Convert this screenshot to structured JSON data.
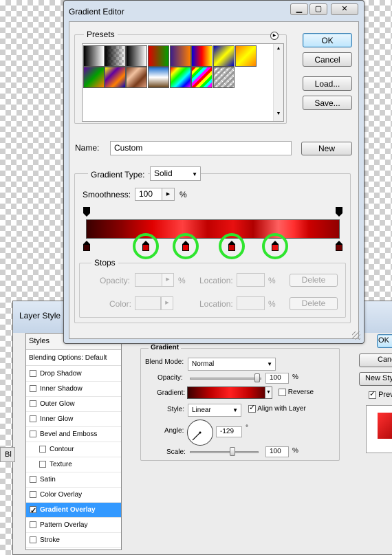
{
  "gradient_editor": {
    "title": "Gradient Editor",
    "presets_label": "Presets",
    "buttons": {
      "ok": "OK",
      "cancel": "Cancel",
      "load": "Load...",
      "save": "Save...",
      "new": "New"
    },
    "name_label": "Name:",
    "name_value": "Custom",
    "gradient_type_label": "Gradient Type:",
    "gradient_type_value": "Solid",
    "smoothness_label": "Smoothness:",
    "smoothness_value": "100",
    "smoothness_unit": "%",
    "stops": {
      "label": "Stops",
      "opacity_label": "Opacity:",
      "opacity_unit": "%",
      "location_label": "Location:",
      "location_unit": "%",
      "color_label": "Color:",
      "delete_label": "Delete"
    }
  },
  "layer_style": {
    "title": "Layer Style",
    "styles_header": "Styles",
    "blending_options": "Blending Options: Default",
    "items": [
      {
        "label": "Drop Shadow",
        "checked": false,
        "indent": false
      },
      {
        "label": "Inner Shadow",
        "checked": false,
        "indent": false
      },
      {
        "label": "Outer Glow",
        "checked": false,
        "indent": false
      },
      {
        "label": "Inner Glow",
        "checked": false,
        "indent": false
      },
      {
        "label": "Bevel and Emboss",
        "checked": false,
        "indent": false
      },
      {
        "label": "Contour",
        "checked": false,
        "indent": true
      },
      {
        "label": "Texture",
        "checked": false,
        "indent": true
      },
      {
        "label": "Satin",
        "checked": false,
        "indent": false
      },
      {
        "label": "Color Overlay",
        "checked": false,
        "indent": false
      },
      {
        "label": "Gradient Overlay",
        "checked": true,
        "indent": false,
        "selected": true
      },
      {
        "label": "Pattern Overlay",
        "checked": false,
        "indent": false
      },
      {
        "label": "Stroke",
        "checked": false,
        "indent": false
      }
    ],
    "gradient_group_label": "Gradient",
    "blend_mode_label": "Blend Mode:",
    "blend_mode_value": "Normal",
    "opacity_label": "Opacity:",
    "opacity_value": "100",
    "opacity_unit": "%",
    "gradient_label": "Gradient:",
    "reverse_label": "Reverse",
    "style_label": "Style:",
    "style_value": "Linear",
    "align_label": "Align with Layer",
    "angle_label": "Angle:",
    "angle_value": "-129",
    "angle_unit": "°",
    "scale_label": "Scale:",
    "scale_value": "100",
    "scale_unit": "%",
    "right_buttons": {
      "ok": "OK",
      "cancel": "Cancel",
      "new_style": "New Style...",
      "preview": "Preview"
    },
    "left_tab": "Bl"
  },
  "colors": {
    "accent": "#3399ff",
    "highlight_circles": "#2ee52e",
    "gradient_dark": "#3a0000",
    "gradient_red": "#e00000"
  }
}
